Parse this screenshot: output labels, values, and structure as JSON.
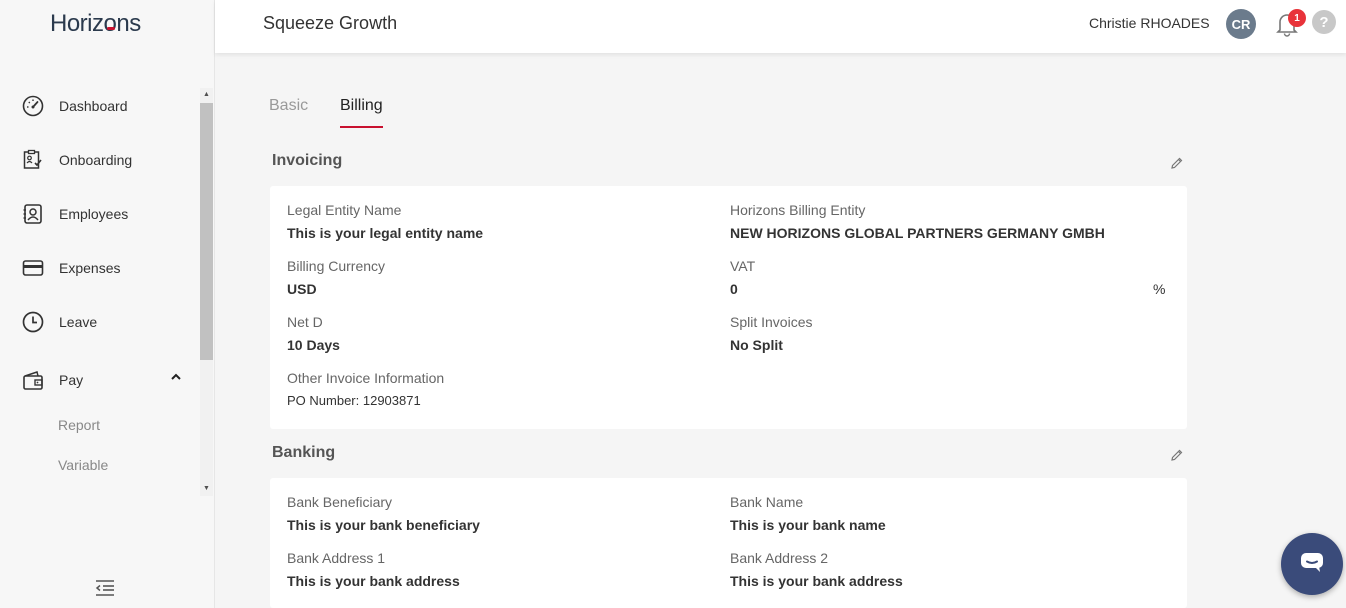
{
  "brand": {
    "logo_text": "Horizons"
  },
  "header": {
    "title": "Squeeze Growth",
    "user_name": "Christie RHOADES",
    "avatar_initials": "CR",
    "notification_count": "1",
    "help_glyph": "?"
  },
  "sidebar": {
    "items": [
      {
        "label": "Dashboard",
        "icon": "dashboard-gauge-icon"
      },
      {
        "label": "Onboarding",
        "icon": "onboarding-clipboard-icon"
      },
      {
        "label": "Employees",
        "icon": "employees-badge-icon"
      },
      {
        "label": "Expenses",
        "icon": "credit-card-icon"
      },
      {
        "label": "Leave",
        "icon": "clock-icon"
      },
      {
        "label": "Pay",
        "icon": "wallet-icon"
      }
    ],
    "pay_subitems": [
      {
        "label": "Report"
      },
      {
        "label": "Variable"
      }
    ]
  },
  "tabs": [
    {
      "label": "Basic"
    },
    {
      "label": "Billing"
    }
  ],
  "active_tab": "Billing",
  "invoicing": {
    "title": "Invoicing",
    "legal_entity_name": {
      "label": "Legal Entity Name",
      "value": "This is your legal entity name"
    },
    "billing_entity": {
      "label": "Horizons Billing Entity",
      "value": "NEW HORIZONS GLOBAL PARTNERS GERMANY GMBH"
    },
    "billing_currency": {
      "label": "Billing Currency",
      "value": "USD"
    },
    "vat": {
      "label": "VAT",
      "value": "0",
      "unit": "%"
    },
    "net_d": {
      "label": "Net D",
      "value": "10 Days"
    },
    "split_invoices": {
      "label": "Split Invoices",
      "value": "No Split"
    },
    "other_info": {
      "label": "Other Invoice Information",
      "value": "PO Number: 12903871"
    }
  },
  "banking": {
    "title": "Banking",
    "bank_beneficiary": {
      "label": "Bank Beneficiary",
      "value": "This is your bank beneficiary"
    },
    "bank_name": {
      "label": "Bank Name",
      "value": "This is your bank name"
    },
    "bank_address_1": {
      "label": "Bank Address 1",
      "value": "This is your bank address"
    },
    "bank_address_2": {
      "label": "Bank Address 2",
      "value": "This is your bank address"
    }
  },
  "colors": {
    "accent": "#c8102e",
    "brand_navy": "#2b3a4d",
    "avatar_bg": "#6b7b8c",
    "badge_red": "#e8333a",
    "chat_bg": "#3a4b7a"
  }
}
